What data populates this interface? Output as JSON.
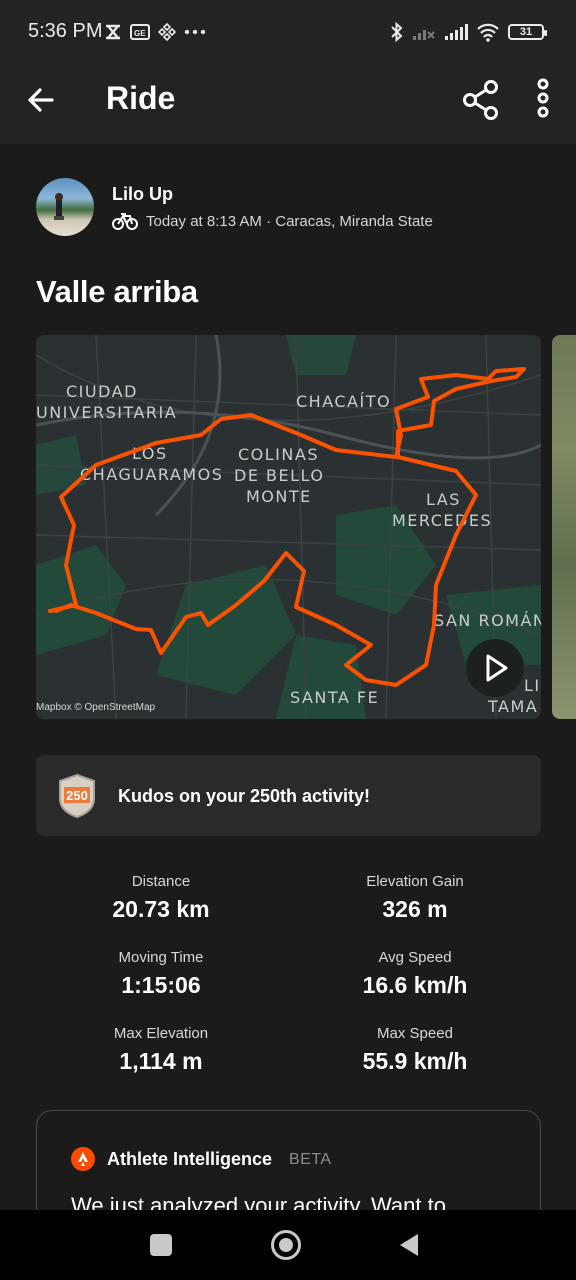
{
  "status_bar": {
    "time": "5:36 PM",
    "battery": "31",
    "icons": [
      "tally-icon",
      "sim-card-icon",
      "binance-icon",
      "more-dots-icon",
      "bluetooth-icon",
      "signal-off-icon",
      "signal-icon",
      "wifi-icon",
      "battery-icon"
    ]
  },
  "app_bar": {
    "title": "Ride",
    "back_icon": "arrow-left-icon",
    "share_icon": "share-icon",
    "more_icon": "more-vertical-icon"
  },
  "athlete": {
    "name": "Lilo Up",
    "meta": "Today at 8:13 AM · Caracas, Miranda State",
    "activity_icon": "bike-icon"
  },
  "activity": {
    "title": "Valle arriba"
  },
  "map": {
    "attribution": "Mapbox © OpenStreetMap",
    "route_color": "#fc5200",
    "labels": {
      "ciudad": "CIUDAD",
      "universitaria": "UNIVERSITARIA",
      "chacaito": "CHACAÍTO",
      "los": "LOS",
      "chaguaramos": "CHAGUARAMOS",
      "colinas": "COLINAS",
      "de_bello": "DE BELLO",
      "monte": "MONTE",
      "las": "LAS",
      "mercedes": "MERCEDES",
      "san_roman": "SAN ROMÁN",
      "santa_fe": "SANTA FE",
      "lin": "LIN",
      "tama": "TAMA"
    }
  },
  "kudos": {
    "badge_number": "250",
    "text": "Kudos on your 250th activity!"
  },
  "stats": [
    {
      "label": "Distance",
      "value": "20.73 km"
    },
    {
      "label": "Elevation Gain",
      "value": "326 m"
    },
    {
      "label": "Moving Time",
      "value": "1:15:06"
    },
    {
      "label": "Avg Speed",
      "value": "16.6 km/h"
    },
    {
      "label": "Max Elevation",
      "value": "1,114 m"
    },
    {
      "label": "Max Speed",
      "value": "55.9 km/h"
    }
  ],
  "athlete_intelligence": {
    "title": "Athlete Intelligence",
    "badge": "BETA",
    "body": "We just analyzed your activity. Want to"
  },
  "colors": {
    "background": "#1b1b1b",
    "bar": "#232323",
    "card": "#2a2a2a",
    "accent": "#fc4c02"
  }
}
